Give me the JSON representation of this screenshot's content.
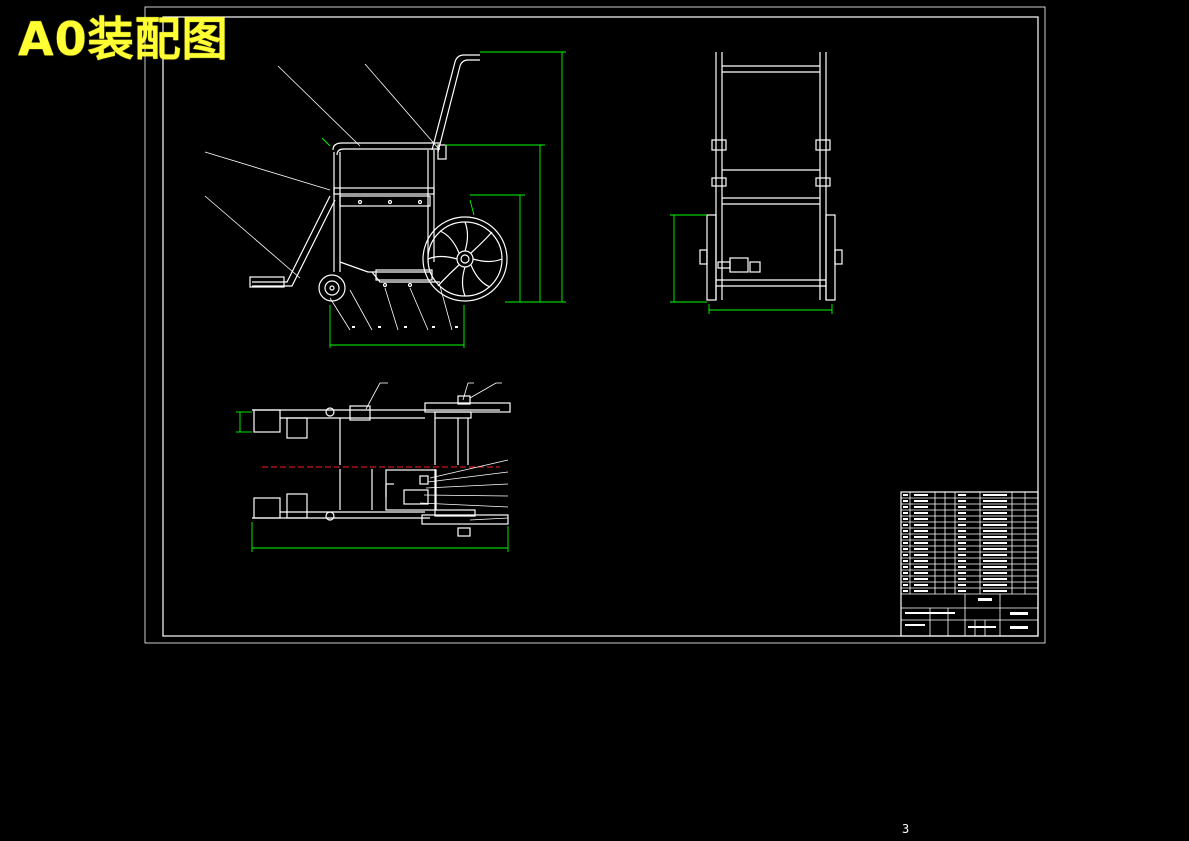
{
  "drawing": {
    "title_overlay": "A0装配图",
    "page_number": "3"
  },
  "colors": {
    "background": "#000000",
    "outline": "#ffffff",
    "dimension": "#00ff00",
    "centerline": "#ff2020",
    "overlay_text": "#ffff33"
  },
  "views": [
    "front-view",
    "side-view",
    "top-view"
  ],
  "title_block": {
    "parts_list_rows": 18,
    "columns": 6
  }
}
